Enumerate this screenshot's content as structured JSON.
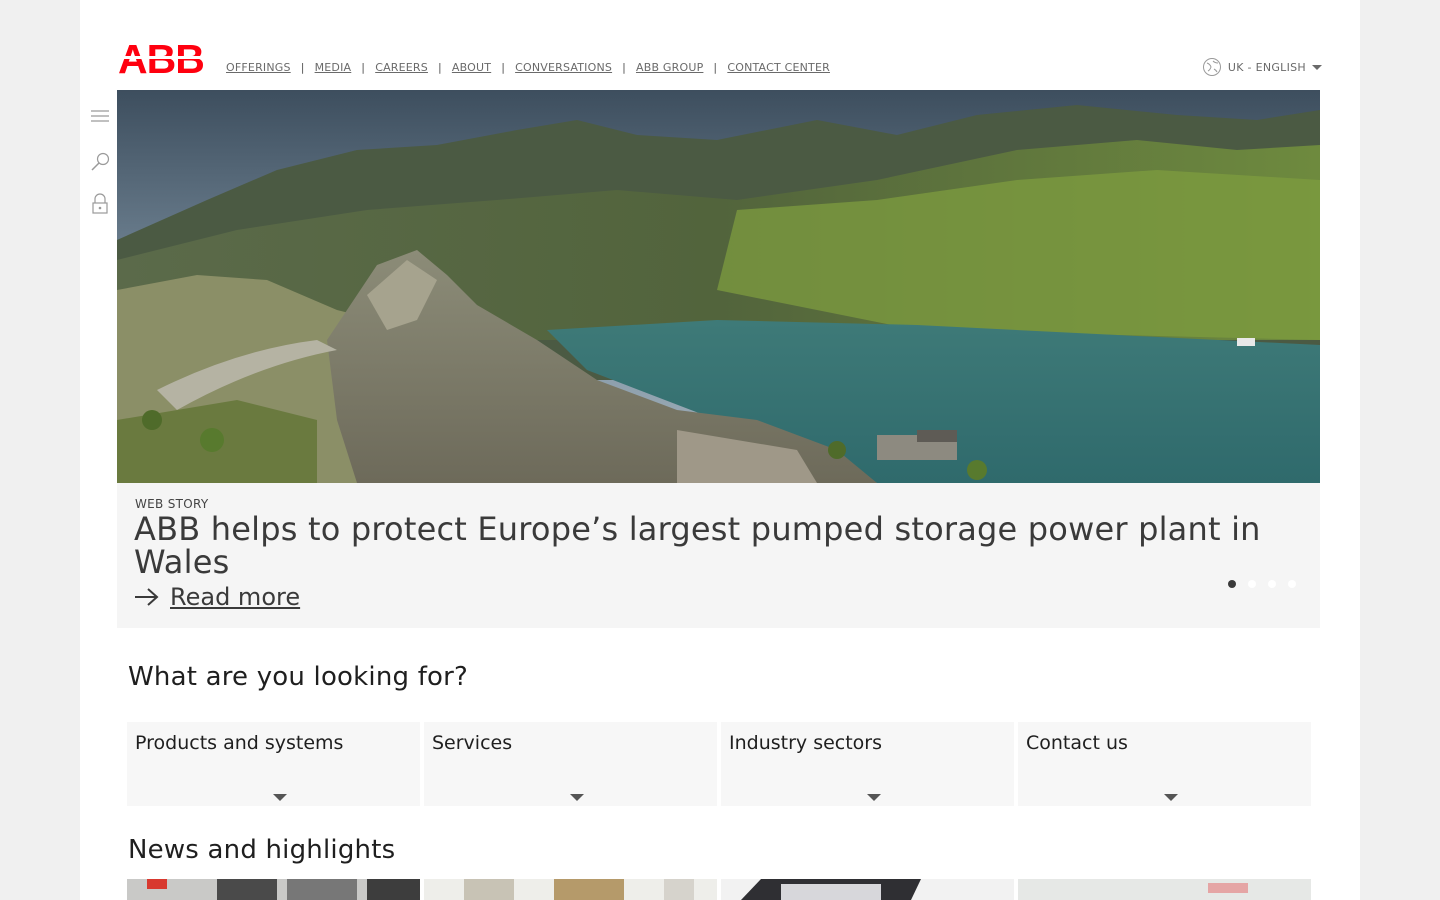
{
  "brand": {
    "logo_text": "ABB",
    "color": "#ff000f"
  },
  "topnav": [
    {
      "label": "OFFERINGS"
    },
    {
      "label": "MEDIA"
    },
    {
      "label": "CAREERS"
    },
    {
      "label": "ABOUT"
    },
    {
      "label": "CONVERSATIONS"
    },
    {
      "label": "ABB GROUP"
    },
    {
      "label": "CONTACT CENTER"
    }
  ],
  "language": {
    "label": "UK - ENGLISH",
    "icon": "globe-icon"
  },
  "side_icons": [
    "menu-icon",
    "search-icon",
    "lock-icon"
  ],
  "hero": {
    "kicker": "WEB STORY",
    "headline": "ABB helps to protect Europe’s largest pumped storage power plant in Wales",
    "read_more": "Read more",
    "slides": 4,
    "active_slide": 1
  },
  "looking_for": {
    "title": "What are you looking for?",
    "cards": [
      {
        "label": "Products and systems"
      },
      {
        "label": "Services"
      },
      {
        "label": "Industry sectors"
      },
      {
        "label": "Contact us"
      }
    ]
  },
  "news": {
    "title": "News and highlights"
  }
}
